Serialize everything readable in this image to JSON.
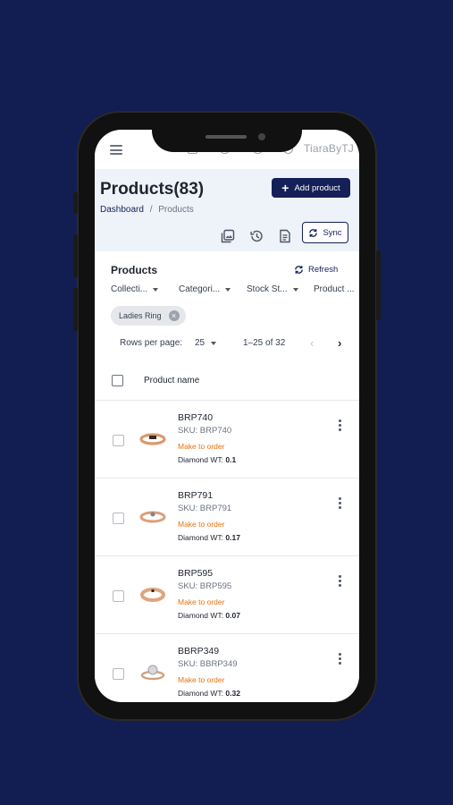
{
  "app": {
    "brand": "TiaraByTJ"
  },
  "header": {
    "title": "Products(83)",
    "add_button_label": "Add product",
    "breadcrumb": {
      "home": "Dashboard",
      "separator": "/",
      "current": "Products"
    },
    "sync_label": "Sync"
  },
  "panel": {
    "title": "Products",
    "refresh_label": "Refresh",
    "filters": [
      "Collecti...",
      "Categori...",
      "Stock St...",
      "Product ..."
    ],
    "active_chip": "Ladies Ring",
    "pagination": {
      "rows_label": "Rows per page:",
      "rows_value": "25",
      "range": "1–25 of 32"
    },
    "column_header": "Product name"
  },
  "products": [
    {
      "name": "BRP740",
      "sku": "SKU: BRP740",
      "status": "Make to order",
      "wt_label": "Diamond WT:",
      "wt_value": "0.1"
    },
    {
      "name": "BRP791",
      "sku": "SKU: BRP791",
      "status": "Make to order",
      "wt_label": "Diamond WT:",
      "wt_value": "0.17"
    },
    {
      "name": "BRP595",
      "sku": "SKU: BRP595",
      "status": "Make to order",
      "wt_label": "Diamond WT:",
      "wt_value": "0.07"
    },
    {
      "name": "BBRP349",
      "sku": "SKU: BBRP349",
      "status": "Make to order",
      "wt_label": "Diamond WT:",
      "wt_value": "0.32"
    }
  ],
  "colors": {
    "primary": "#142057",
    "background": "#121e52",
    "status": "#e8730c"
  }
}
